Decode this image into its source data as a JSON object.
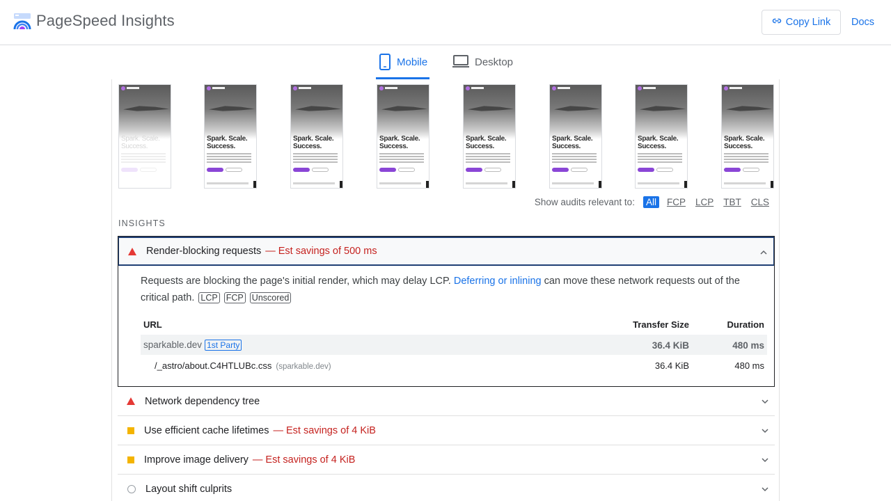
{
  "header": {
    "app_title": "PageSpeed Insights",
    "copy_link_label": "Copy Link",
    "docs_label": "Docs"
  },
  "tabs": [
    {
      "label": "Mobile",
      "selected": true
    },
    {
      "label": "Desktop",
      "selected": false
    }
  ],
  "filmstrip": {
    "frames": [
      {
        "heading": "Spark. Scale. Success.",
        "state": "loading"
      },
      {
        "heading": "Spark. Scale. Success.",
        "state": "loaded"
      },
      {
        "heading": "Spark. Scale. Success.",
        "state": "loaded"
      },
      {
        "heading": "Spark. Scale. Success.",
        "state": "loaded"
      },
      {
        "heading": "Spark. Scale. Success.",
        "state": "loaded"
      },
      {
        "heading": "Spark. Scale. Success.",
        "state": "loaded"
      },
      {
        "heading": "Spark. Scale. Success.",
        "state": "loaded"
      },
      {
        "heading": "Spark. Scale. Success.",
        "state": "loaded"
      }
    ]
  },
  "audit_filter": {
    "label": "Show audits relevant to:",
    "chips": [
      "All",
      "FCP",
      "LCP",
      "TBT",
      "CLS"
    ],
    "active": "All"
  },
  "insights": {
    "section_title": "INSIGHTS",
    "expanded": {
      "title": "Render-blocking requests",
      "savings": "— Est savings of 500 ms",
      "severity_color": "#e53935",
      "description_before": "Requests are blocking the page's initial render, which may delay LCP.",
      "description_link": "Deferring or inlining",
      "description_after": "can move these network requests out of the critical path.",
      "tags": [
        "LCP",
        "FCP",
        "Unscored"
      ],
      "table": {
        "headers": {
          "url": "URL",
          "size": "Transfer Size",
          "duration": "Duration"
        },
        "party": {
          "name": "sparkable.dev",
          "badge": "1st Party",
          "size": "36.4 KiB",
          "duration": "480 ms"
        },
        "items": [
          {
            "url": "/_astro/about.C4HTLUBc.css",
            "host": "(sparkable.dev)",
            "size": "36.4 KiB",
            "duration": "480 ms"
          }
        ]
      }
    },
    "collapsed": [
      {
        "title": "Network dependency tree",
        "savings": "",
        "severity": "fail"
      },
      {
        "title": "Use efficient cache lifetimes",
        "savings": "— Est savings of 4 KiB",
        "severity": "average"
      },
      {
        "title": "Improve image delivery",
        "savings": "— Est savings of 4 KiB",
        "severity": "average"
      },
      {
        "title": "Layout shift culprits",
        "savings": "",
        "severity": "info"
      }
    ]
  },
  "colors": {
    "accent": "#1a73e8",
    "fail": "#e53935",
    "average": "#f4b400",
    "savings_text": "#c5221f"
  },
  "icons": [
    "pagespeed-logo-icon",
    "link-icon",
    "mobile-icon",
    "desktop-icon",
    "chevron-up-icon",
    "chevron-down-icon",
    "triangle-fail-icon",
    "square-average-icon",
    "circle-info-icon"
  ]
}
